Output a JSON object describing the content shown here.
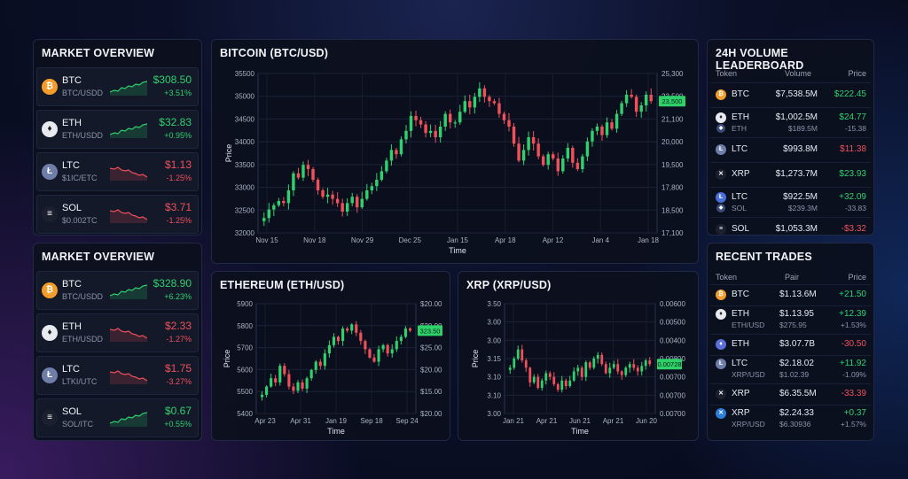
{
  "colors": {
    "up": "#31d06e",
    "down": "#f0505a",
    "price_tag": "#2ed06a"
  },
  "market_overview_1": {
    "title": "MARKET OVERVIEW",
    "rows": [
      {
        "sym": "BTC",
        "pair": "BTC/USDD",
        "price": "$308.50",
        "change": "+3.51%",
        "dir": "up",
        "icon": "bitcoin-icon",
        "glyph": "₿",
        "color": "#f39c2a"
      },
      {
        "sym": "ETH",
        "pair": "ETH/USDD",
        "price": "$32.83",
        "change": "+0.95%",
        "dir": "up",
        "icon": "ethereum-icon",
        "glyph": "♦",
        "color": "#e8eaf0"
      },
      {
        "sym": "LTC",
        "pair": "$1IC/ETC",
        "price": "$1.13",
        "change": "-1.25%",
        "dir": "down",
        "icon": "litecoin-icon",
        "glyph": "Ł",
        "color": "#6f7ea8"
      },
      {
        "sym": "SOL",
        "pair": "$0.002TC",
        "price": "$3.71",
        "change": "-1.25%",
        "dir": "down",
        "icon": "solana-icon",
        "glyph": "≡",
        "color": "#1b1f2e"
      }
    ]
  },
  "market_overview_2": {
    "title": "MARKET OVERVIEW",
    "rows": [
      {
        "sym": "BTC",
        "pair": "BTC/USDD",
        "price": "$328.90",
        "change": "+6.23%",
        "dir": "up",
        "icon": "bitcoin-icon",
        "glyph": "₿",
        "color": "#f39c2a"
      },
      {
        "sym": "ETH",
        "pair": "ETH/USDD",
        "price": "$2.33",
        "change": "-1.27%",
        "dir": "down",
        "icon": "ethereum-icon",
        "glyph": "♦",
        "color": "#e8eaf0"
      },
      {
        "sym": "LTC",
        "pair": "LTKI/UTC",
        "price": "$1.75",
        "change": "-3.27%",
        "dir": "down",
        "icon": "litecoin-icon",
        "glyph": "Ł",
        "color": "#6f7ea8"
      },
      {
        "sym": "SOL",
        "pair": "SOL/ITC",
        "price": "$0.67",
        "change": "+0.55%",
        "dir": "up",
        "icon": "solana-icon",
        "glyph": "≡",
        "color": "#1b1f2e"
      }
    ]
  },
  "leaderboard": {
    "title": "24H VOLUME LEADERBOARD",
    "headers": {
      "token": "Token",
      "volume": "Volume",
      "price": "Price"
    },
    "rows": [
      {
        "token": "BTC",
        "volume": "$7,538.5M",
        "price": "$222.45",
        "dir": "up",
        "icon": "bitcoin-icon",
        "glyph": "₿",
        "color": "#f39c2a"
      },
      {
        "token": "ETH",
        "volume": "$1,002.5M",
        "price": "$24.77",
        "dir": "up",
        "icon": "ethereum-icon",
        "glyph": "♦",
        "color": "#e8eaf0",
        "sub": {
          "token": "ETH",
          "volume": "$189.5M",
          "price": "-15.38",
          "dir": "down"
        }
      },
      {
        "token": "LTC",
        "volume": "$993.8M",
        "price": "$11.38",
        "dir": "down",
        "icon": "litecoin-icon",
        "glyph": "Ł",
        "color": "#6f7ea8"
      },
      {
        "token": "XRP",
        "volume": "$1,273.7M",
        "price": "$23.93",
        "dir": "up",
        "icon": "xrp-icon",
        "glyph": "✕",
        "color": "#1b1f2e"
      },
      {
        "token": "LTC",
        "volume": "$922.5M",
        "price": "+32.09",
        "dir": "up",
        "icon": "litecoin-icon",
        "glyph": "Ł",
        "color": "#4a6fd8",
        "sub": {
          "token": "SOL",
          "volume": "$239.3M",
          "price": "-33.83",
          "dir": "down"
        }
      },
      {
        "token": "SOL",
        "volume": "$1,053.3M",
        "price": "-$3.32",
        "dir": "down",
        "icon": "solana-icon",
        "glyph": "≡",
        "color": "#1b1f2e"
      }
    ]
  },
  "recent_trades": {
    "title": "RECENT TRADES",
    "headers": {
      "token": "Token",
      "pair": "Pair",
      "price": "Price"
    },
    "rows": [
      {
        "token": "BTC",
        "pair": "$1.13.6M",
        "price": "+21.50",
        "dir": "up",
        "icon": "bitcoin-icon",
        "glyph": "₿",
        "color": "#f39c2a"
      },
      {
        "token": "ETH",
        "sub_token": "ETH/USD",
        "pair": "$1.13.95",
        "sub_pair": "$275.95",
        "price": "+12.39",
        "sub_price": "+1.53%",
        "dir": "up",
        "icon": "ethereum-icon",
        "glyph": "♦",
        "color": "#e8eaf0"
      },
      {
        "token": "ETH",
        "pair": "$3.07.7B",
        "price": "-30.50",
        "dir": "down",
        "icon": "ethereum-icon",
        "glyph": "♦",
        "color": "#5a6fd8"
      },
      {
        "token": "LTC",
        "sub_token": "XRP/USD",
        "pair": "$2.18.02",
        "sub_pair": "$1.02.39",
        "price": "+11.92",
        "sub_price": "-1.09%",
        "dir": "up",
        "sub_dir": "down",
        "icon": "litecoin-icon",
        "glyph": "Ł",
        "color": "#6f7ea8"
      },
      {
        "token": "XRP",
        "pair": "$6.35.5M",
        "price": "-33.39",
        "dir": "down",
        "icon": "xrp-icon",
        "glyph": "✕",
        "color": "#1b1f2e"
      },
      {
        "token": "XRP",
        "sub_token": "XRP/USD",
        "pair": "$2.24.33",
        "sub_pair": "$6.30936",
        "price": "+0.37",
        "sub_price": "+1.57%",
        "dir": "up",
        "icon": "xrp-icon",
        "glyph": "✕",
        "color": "#2a7fd8"
      }
    ]
  },
  "chart_data": [
    {
      "type": "candlestick",
      "title": "BITCOIN (BTC/USD)",
      "xlabel": "Time",
      "ylabel": "Price",
      "x_ticks": [
        "Nov 15",
        "Nov 18",
        "Nov 29",
        "Dec 25",
        "Jan 15",
        "Apr 18",
        "Apr 12",
        "Jan 4",
        "Jan 18"
      ],
      "y_ticks": [
        32000,
        32500,
        33000,
        33500,
        34000,
        34500,
        35000,
        35500
      ],
      "ylim": [
        31900,
        35650
      ],
      "y2_ticks": [
        "25,300",
        "23,500",
        "21,100",
        "20,000",
        "19,500",
        "17,800",
        "18,500",
        "17,100"
      ],
      "price_tag": "23,500",
      "close": [
        32250,
        32450,
        32550,
        32650,
        32600,
        32900,
        33300,
        33200,
        33500,
        33400,
        33150,
        32900,
        32750,
        32800,
        32700,
        32600,
        32400,
        32600,
        32750,
        32500,
        32700,
        32900,
        33000,
        33150,
        33350,
        33600,
        33850,
        33750,
        34100,
        34300,
        34650,
        34550,
        34450,
        34250,
        34300,
        34150,
        34400,
        34700,
        34500,
        34500,
        34750,
        35000,
        34850,
        35100,
        35300,
        35100,
        35000,
        34950,
        34700,
        34550,
        34400,
        34000,
        33600,
        33850,
        34150,
        34000,
        33700,
        33500,
        33750,
        33650,
        33350,
        33650,
        33900,
        33550,
        33400,
        33700,
        34050,
        34300,
        34400,
        34200,
        34500,
        34350,
        34700,
        34950,
        35150,
        35100,
        34750,
        34900,
        35150,
        35000
      ]
    },
    {
      "type": "candlestick",
      "title": "ETHEREUM (ETH/USD)",
      "xlabel": "Time",
      "ylabel": "Price",
      "x_ticks": [
        "Apr 23",
        "Apr 31",
        "Jan 19",
        "Sep 18",
        "Sep 24"
      ],
      "y_ticks": [
        5400,
        5500,
        5600,
        5700,
        5800,
        5900
      ],
      "ylim": [
        5390,
        5920
      ],
      "y2_ticks": [
        "$20.00",
        "$20.00",
        "$25.00",
        "$20.00",
        "$15.00",
        "$20.00"
      ],
      "price_tag": "323.50",
      "close": [
        5480,
        5520,
        5560,
        5540,
        5620,
        5580,
        5520,
        5500,
        5540,
        5510,
        5560,
        5600,
        5640,
        5620,
        5680,
        5720,
        5760,
        5740,
        5800,
        5790,
        5820,
        5780,
        5740,
        5700,
        5660,
        5640,
        5700,
        5720,
        5680,
        5700,
        5740,
        5760,
        5800,
        5790
      ]
    },
    {
      "type": "candlestick",
      "title": "XRP (XRP/USD)",
      "xlabel": "Time",
      "ylabel": "Price",
      "x_ticks": [
        "Jan 21",
        "Apr 21",
        "Jun 21",
        "Apr 21",
        "Jun 20"
      ],
      "y_ticks": [
        "3.00",
        "3.10",
        "3.10",
        "3.15",
        "3.00",
        "3.00",
        "3.50"
      ],
      "ylim": [
        2.95,
        3.55
      ],
      "y2_ticks": [
        "0.00600",
        "0.00500",
        "0.00400",
        "0.00800",
        "0.00700",
        "0.00700",
        "0.00700"
      ],
      "price_tag": "0.00728",
      "close": [
        3.2,
        3.25,
        3.3,
        3.24,
        3.2,
        3.12,
        3.15,
        3.09,
        3.13,
        3.17,
        3.15,
        3.11,
        3.08,
        3.13,
        3.1,
        3.13,
        3.18,
        3.2,
        3.15,
        3.23,
        3.2,
        3.25,
        3.27,
        3.22,
        3.17,
        3.2,
        3.22,
        3.18,
        3.16,
        3.2,
        3.22,
        3.2,
        3.18,
        3.21,
        3.24,
        3.22
      ]
    }
  ]
}
